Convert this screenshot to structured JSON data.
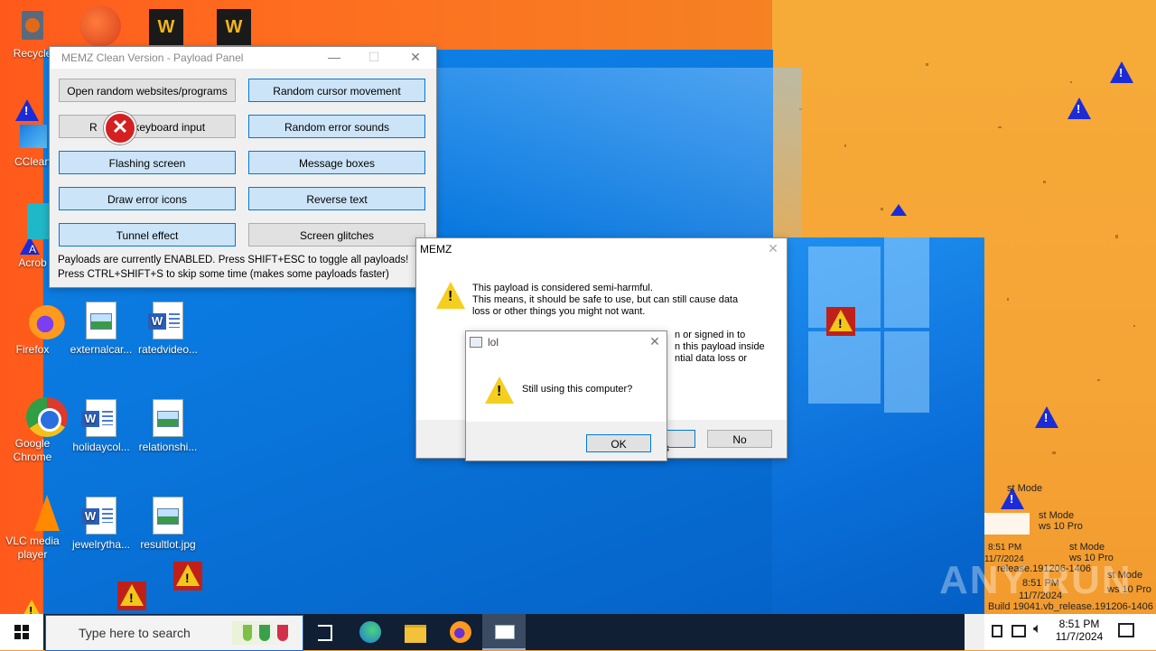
{
  "desktop": {
    "icons": [
      {
        "label": "Recycle",
        "kind": "recycle"
      },
      {
        "label": "CClean",
        "kind": "ccleaner"
      },
      {
        "label": "A",
        "label2": "Acrob",
        "kind": "acrobat"
      },
      {
        "label": "Firefox",
        "kind": "firefox"
      },
      {
        "label": "Google",
        "label2": "Chrome",
        "kind": "chrome"
      },
      {
        "label": "VLC media",
        "label2": "player",
        "kind": "vlc"
      },
      {
        "label": "externalcar...",
        "kind": "image"
      },
      {
        "label": "ratedvideo...",
        "kind": "word"
      },
      {
        "label": "holidaycol...",
        "kind": "word"
      },
      {
        "label": "relationshi...",
        "kind": "image"
      },
      {
        "label": "jewelrytha...",
        "kind": "word"
      },
      {
        "label": "resultlot.jpg",
        "kind": "image"
      }
    ],
    "edge_icon_stray": "R"
  },
  "payload_panel": {
    "title": "MEMZ Clean Version - Payload Panel",
    "buttons": [
      {
        "label": "Open random websites/programs",
        "enabled": false
      },
      {
        "label": "Random cursor movement",
        "enabled": true
      },
      {
        "label": "R",
        "label_rest": "keyboard input",
        "enabled": false
      },
      {
        "label": "Random error sounds",
        "enabled": true
      },
      {
        "label": "Flashing screen",
        "enabled": true
      },
      {
        "label": "Message boxes",
        "enabled": true
      },
      {
        "label": "Draw error icons",
        "enabled": true
      },
      {
        "label": "Reverse text",
        "enabled": true
      },
      {
        "label": "Tunnel effect",
        "enabled": true
      },
      {
        "label": "Screen glitches",
        "enabled": false
      }
    ],
    "status_line1": "Payloads are currently ENABLED. Press SHIFT+ESC to toggle all payloads!",
    "status_line2": "Press CTRL+SHIFT+S to skip some time (makes some payloads faster)"
  },
  "memz_dialog": {
    "title": "MEMZ",
    "line1": "This payload is considered semi-harmful.",
    "line2": "This means, it should be safe to use, but can still cause data",
    "line3": "loss or other things you might not want.",
    "partial1": "n or signed in to",
    "partial2": "n this payload inside",
    "partial3": "ntial data loss or",
    "yes_partial": "s",
    "no_label": "No"
  },
  "lol_dialog": {
    "title": "lol",
    "message": "Still using this computer?",
    "ok_label": "OK"
  },
  "taskbar": {
    "search_placeholder": "Type here to search",
    "time": "8:51 PM",
    "date": "11/7/2024"
  },
  "ghost_tray": [
    {
      "time": "8:51 PM",
      "date": "11/7/2024"
    },
    {
      "time": "8:51 PM",
      "date": "11/7/2024"
    }
  ],
  "ghost_text": {
    "mode": "st Mode",
    "pro": "ws 10 Pro",
    "build": "Build 19041.vb_release.191206-1406",
    "build_short": "release.191206-1406"
  },
  "watermark": "ANY RUN"
}
